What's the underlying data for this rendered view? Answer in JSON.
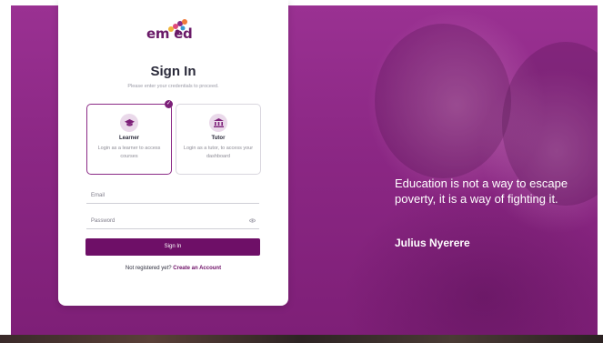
{
  "brand": {
    "logo_text": "em ed"
  },
  "login": {
    "title": "Sign In",
    "subtitle": "Please enter your credentials to proceed.",
    "roles": [
      {
        "title": "Learner",
        "description": "Login as a learner to access courses",
        "selected": true,
        "icon": "graduation-cap-icon"
      },
      {
        "title": "Tutor",
        "description": "Login as a tutor, to access your dashboard",
        "selected": false,
        "icon": "institution-icon"
      }
    ],
    "email_placeholder": "Email",
    "password_placeholder": "Password",
    "signin_label": "Sign In",
    "register_prompt": "Not registered yet?",
    "register_link": "Create an Account"
  },
  "hero": {
    "quote": "Education is not a way to escape poverty, it is a way of fighting it.",
    "author": "Julius Nyerere"
  },
  "colors": {
    "brand_purple": "#6e0f67",
    "hero_overlay": "#8e2a86",
    "check_badge": "#7c1f78"
  }
}
